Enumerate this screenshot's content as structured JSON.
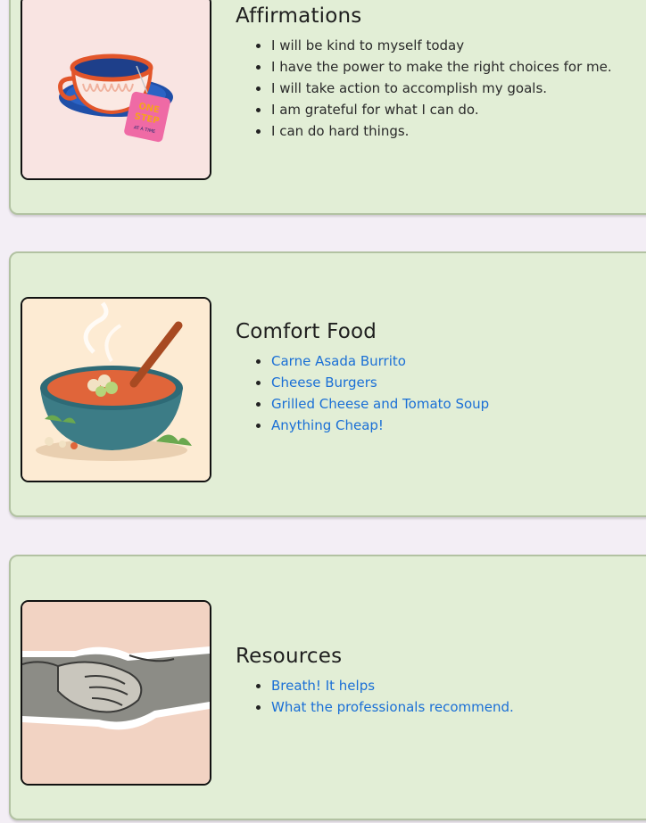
{
  "sections": [
    {
      "title": "Affirmations",
      "image_icon": "tea-cup-one-step-at-a-time",
      "image_text": "ONE STEP AT A TIME",
      "items": [
        "I will be kind to myself today",
        "I have the power to make the right choices for me.",
        "I will take action to accomplish my goals.",
        "I am grateful for what I can do.",
        "I can do hard things."
      ]
    },
    {
      "title": "Comfort Food",
      "image_icon": "soup-bowl",
      "items": [
        "Carne Asada Burrito",
        "Cheese Burgers",
        "Grilled Cheese and Tomato Soup",
        "Anything Cheap!"
      ]
    },
    {
      "title": "Resources",
      "image_icon": "handshake",
      "items": [
        "Breath! It helps",
        "What the professionals recommend."
      ]
    }
  ],
  "colors": {
    "page_background": "#f3eef5",
    "card_background": "#e2eed6",
    "card_border": "#b2c2a2",
    "link": "#1a6fd6",
    "text": "#2a2a2a"
  }
}
